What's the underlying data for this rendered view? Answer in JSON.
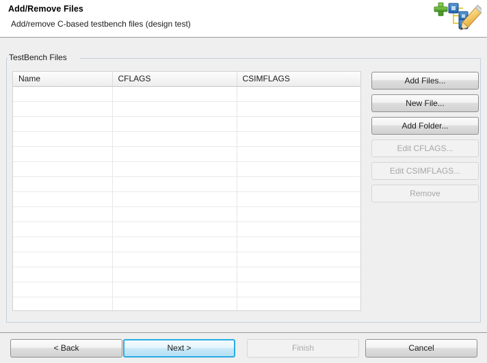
{
  "window": {
    "title": "Add/Remove Files",
    "subtitle": "Add/remove C-based testbench files (design test)",
    "icon": "add-edit-files-icon"
  },
  "group": {
    "label": "TestBench Files"
  },
  "table": {
    "columns": [
      "Name",
      "CFLAGS",
      "CSIMFLAGS"
    ],
    "rows": [],
    "empty_row_count": 15
  },
  "side_buttons": [
    {
      "label": "Add Files...",
      "name": "add-files-button",
      "enabled": true
    },
    {
      "label": "New File...",
      "name": "new-file-button",
      "enabled": true
    },
    {
      "label": "Add Folder...",
      "name": "add-folder-button",
      "enabled": true
    },
    {
      "label": "Edit CFLAGS...",
      "name": "edit-cflags-button",
      "enabled": false
    },
    {
      "label": "Edit CSIMFLAGS...",
      "name": "edit-csimflags-button",
      "enabled": false
    },
    {
      "label": "Remove",
      "name": "remove-button",
      "enabled": false
    }
  ],
  "nav_buttons": {
    "back": "< Back",
    "next": "Next >",
    "finish": "Finish",
    "cancel": "Cancel"
  },
  "colors": {
    "accent": "#29abe2",
    "background": "#efefef",
    "header_background": "#ffffff",
    "table_background": "#ffffff",
    "disabled_text": "#a6a6a6"
  }
}
